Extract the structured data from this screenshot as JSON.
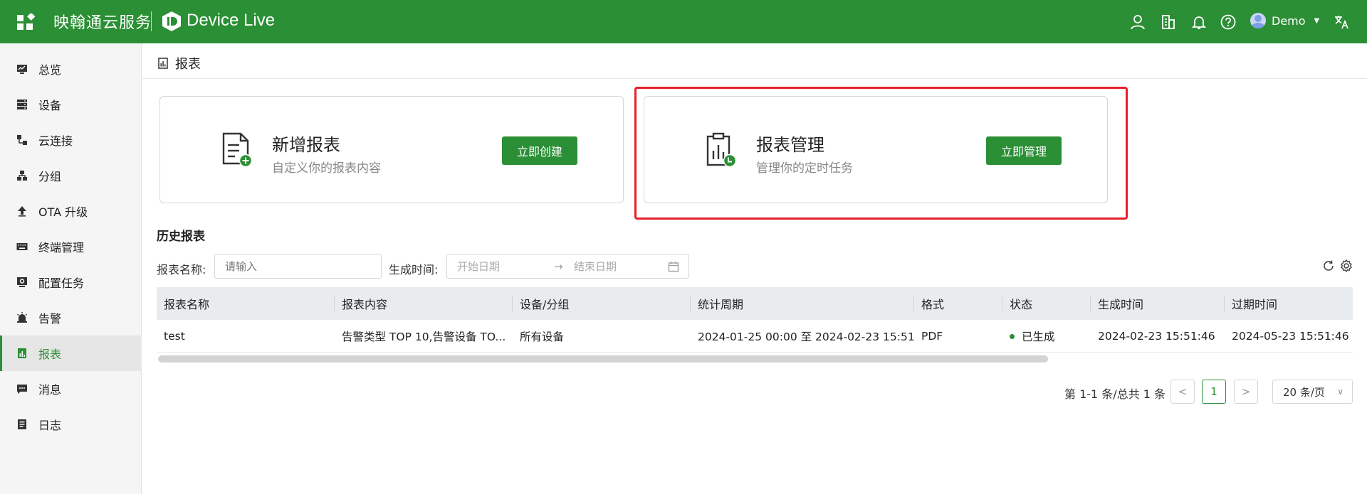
{
  "header": {
    "brand": "映翰通云服务",
    "product": "Device Live",
    "user": "Demo"
  },
  "sidebar": {
    "items": [
      {
        "label": "总览",
        "icon": "monitor-icon"
      },
      {
        "label": "设备",
        "icon": "server-icon"
      },
      {
        "label": "云连接",
        "icon": "connection-icon"
      },
      {
        "label": "分组",
        "icon": "group-icon"
      },
      {
        "label": "OTA 升级",
        "icon": "upload-icon"
      },
      {
        "label": "终端管理",
        "icon": "keyboard-icon"
      },
      {
        "label": "配置任务",
        "icon": "config-icon"
      },
      {
        "label": "告警",
        "icon": "alarm-icon"
      },
      {
        "label": "报表",
        "icon": "report-icon",
        "active": true
      },
      {
        "label": "消息",
        "icon": "message-icon"
      },
      {
        "label": "日志",
        "icon": "log-icon"
      }
    ]
  },
  "breadcrumb": {
    "title": "报表"
  },
  "cards": {
    "new_report": {
      "title": "新增报表",
      "subtitle": "自定义你的报表内容",
      "button": "立即创建"
    },
    "manage_report": {
      "title": "报表管理",
      "subtitle": "管理你的定时任务",
      "button": "立即管理"
    }
  },
  "history": {
    "title": "历史报表",
    "filters": {
      "name_label": "报表名称:",
      "name_placeholder": "请输入",
      "time_label": "生成时间:",
      "start_placeholder": "开始日期",
      "end_placeholder": "结束日期"
    },
    "columns": [
      "报表名称",
      "报表内容",
      "设备/分组",
      "统计周期",
      "格式",
      "状态",
      "生成时间",
      "过期时间"
    ],
    "rows": [
      {
        "name": "test",
        "content": "告警类型 TOP 10,告警设备 TO...",
        "device": "所有设备",
        "period": "2024-01-25 00:00 至 2024-02-23 15:51",
        "format": "PDF",
        "status": "已生成",
        "created": "2024-02-23 15:51:46",
        "expires": "2024-05-23 15:51:46"
      }
    ]
  },
  "pagination": {
    "total": "第 1-1 条/总共 1 条",
    "current": "1",
    "page_size": "20 条/页"
  },
  "colors": {
    "primary": "#2b8f35",
    "highlight": "#e8202a"
  }
}
